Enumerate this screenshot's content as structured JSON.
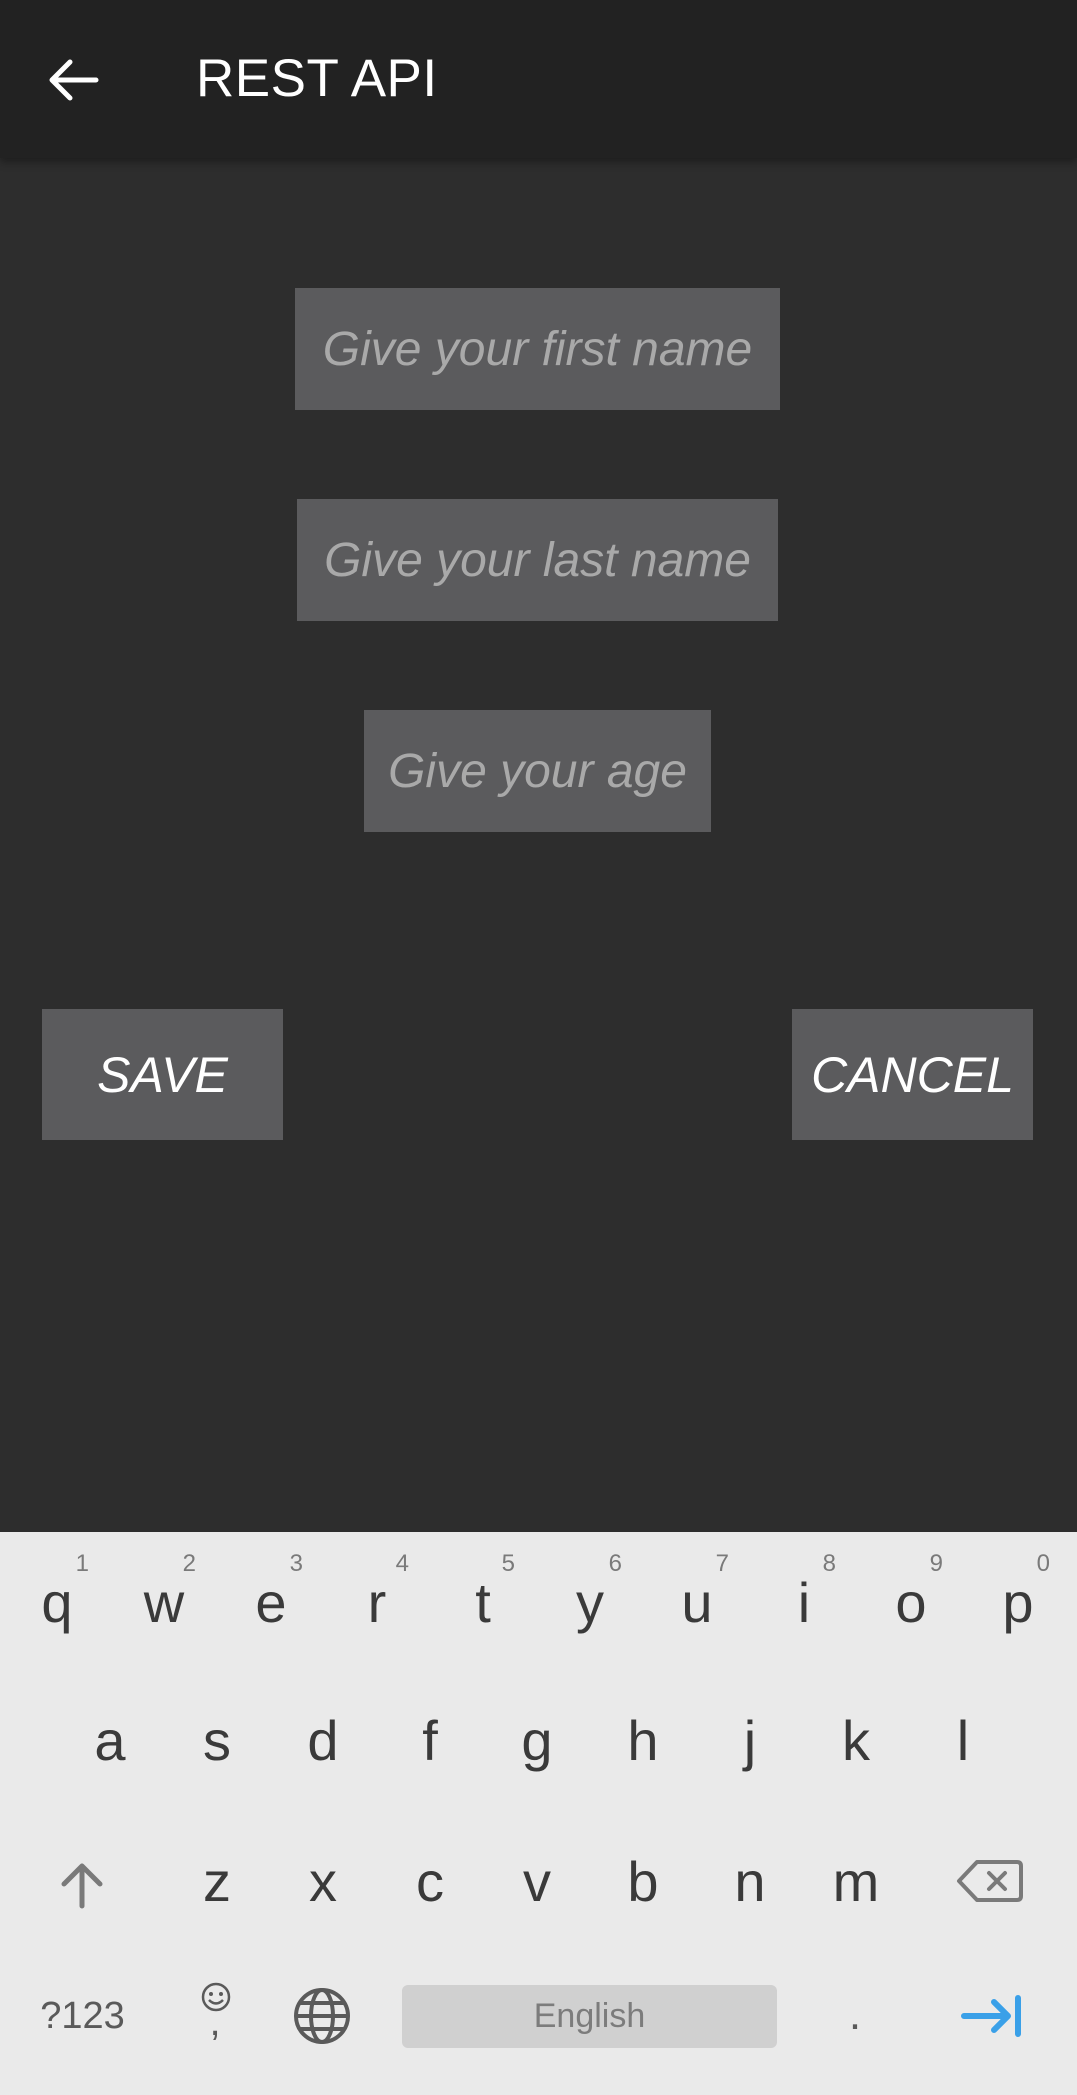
{
  "app_bar": {
    "title": "REST API",
    "back_icon": "arrow-left-icon"
  },
  "form": {
    "first_name_placeholder": "Give your first name",
    "last_name_placeholder": "Give your last name",
    "age_placeholder": "Give your age"
  },
  "actions": {
    "save_label": "SAVE",
    "cancel_label": "CANCEL"
  },
  "keyboard": {
    "row1": [
      {
        "k": "q",
        "h": "1"
      },
      {
        "k": "w",
        "h": "2"
      },
      {
        "k": "e",
        "h": "3"
      },
      {
        "k": "r",
        "h": "4"
      },
      {
        "k": "t",
        "h": "5"
      },
      {
        "k": "y",
        "h": "6"
      },
      {
        "k": "u",
        "h": "7"
      },
      {
        "k": "i",
        "h": "8"
      },
      {
        "k": "o",
        "h": "9"
      },
      {
        "k": "p",
        "h": "0"
      }
    ],
    "row2": [
      "a",
      "s",
      "d",
      "f",
      "g",
      "h",
      "j",
      "k",
      "l"
    ],
    "row3": [
      "z",
      "x",
      "c",
      "v",
      "b",
      "n",
      "m"
    ],
    "symbols_label": "?123",
    "comma_label": ",",
    "space_label": "English",
    "period_label": ".",
    "icons": [
      "shift-icon",
      "backspace-icon",
      "emoji-icon",
      "globe-icon",
      "tab-next-icon"
    ],
    "accent_color": "#3aa0e8"
  }
}
